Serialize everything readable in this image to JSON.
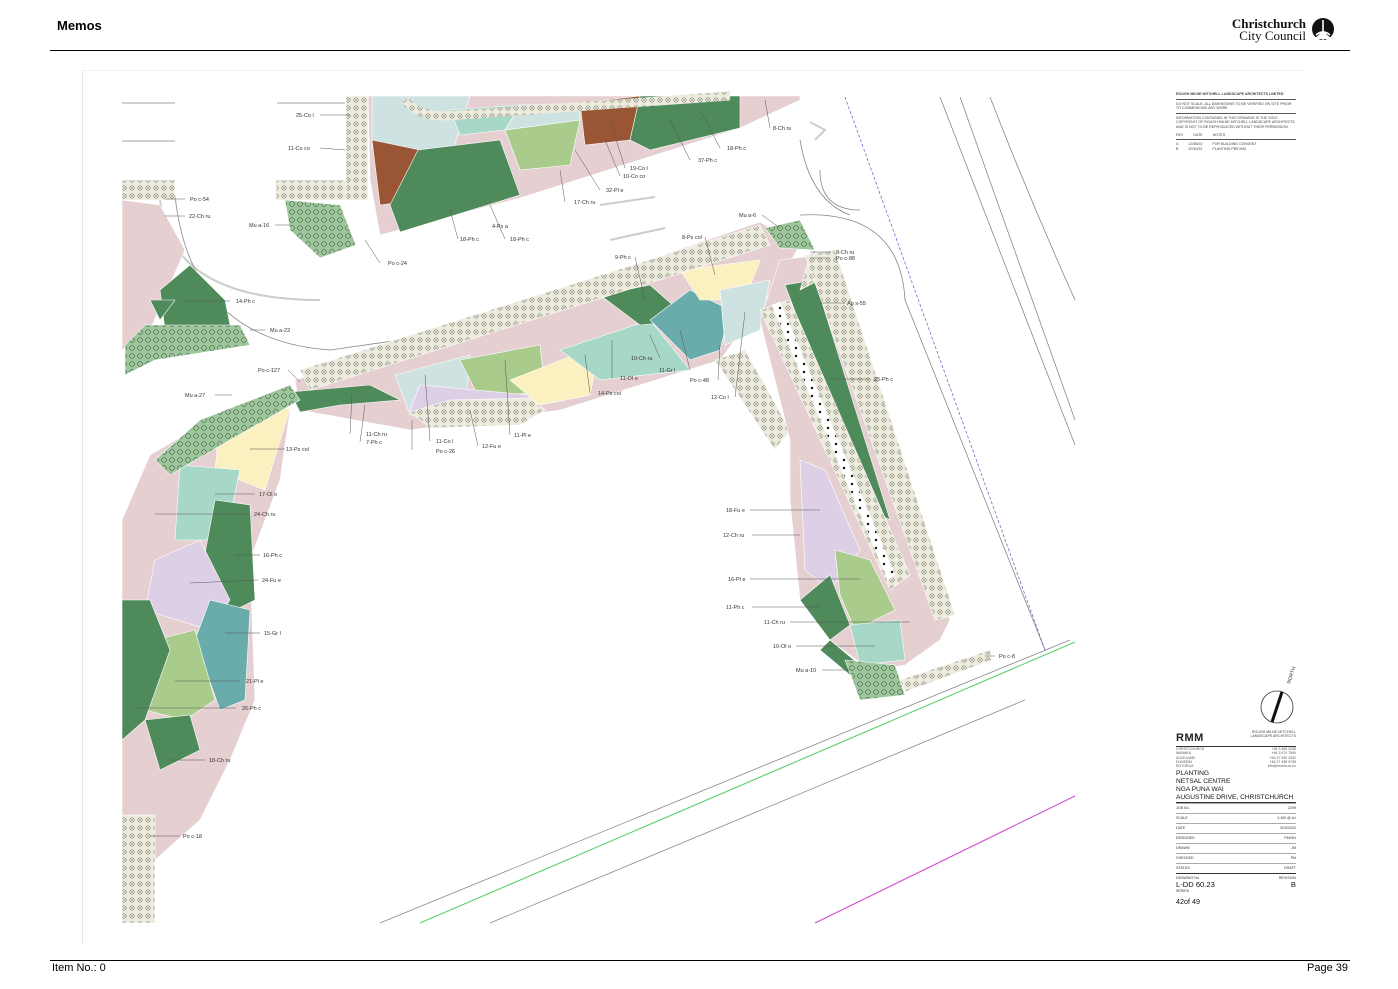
{
  "header": {
    "title": "Memos",
    "logo": {
      "line1": "Christchurch",
      "line2": "City Council"
    }
  },
  "footer": {
    "item_no": "Item No.: 0",
    "page": "Page 39"
  },
  "colors": {
    "dark_green": "#4f8a5b",
    "sage_green": "#a9cc8c",
    "pink": "#e5cfd0",
    "light_blue": "#cfe2e2",
    "mint": "#a7d7c6",
    "teal": "#6aabab",
    "lavender": "#ddd0e6",
    "pale_yellow": "#fbf0c0",
    "brown": "#9a5534",
    "mulch_cream": "#ecebdc",
    "mulch_green": "#9cc79a",
    "green_line": "#5bd06f",
    "magenta_line": "#d24ad8"
  },
  "north_label": "NORTH",
  "plant_labels": [
    "25-Co l",
    "11-Co co",
    "Po c-54",
    "22-Ch ru",
    "Mu a-16",
    "Po c-24",
    "18-Ph c",
    "18-Ph c",
    "4-Ps a",
    "17-Ch ru",
    "32-Pl e",
    "10-Co co",
    "19-Co l",
    "37-Ph c",
    "18-Ph c",
    "8-Ch ru",
    "Mu a-6",
    "8-Ps col",
    "8-Ch ru",
    "Po c-88",
    "9-Ph c",
    "14-Ph c",
    "Mu a-22",
    "Ap s-55",
    "Po c-127",
    "10-Ch ru",
    "11-Gr l",
    "11-Ol o",
    "Po c-48",
    "14-Ps col",
    "12-Co l",
    "25-Ph c",
    "Mu a-27",
    "11-Ch ru",
    "7-Ph c",
    "11-Co l",
    "Po c-26",
    "12-Fu e",
    "11-Pl e",
    "13-Ps col",
    "17-Ol o",
    "24-Ch ru",
    "16-Ph c",
    "24-Fu e",
    "15-Gr l",
    "21-Pl e",
    "26-Ph c",
    "18-Ch ru",
    "Po c-18",
    "18-Fu e",
    "12-Ch ru",
    "16-Pl e",
    "11-Ph c",
    "11-Ch ru",
    "10-Ol o",
    "Mu a-10",
    "Po c-8"
  ],
  "notes_block": [
    "ROUGH MILNE MITCHELL LANDSCAPE ARCHITECTS LIMITED",
    "DO NOT SCALE. ALL DIMENSIONS TO BE VERIFIED ON SITE PRIOR",
    "TO COMMENCING ANY WORK",
    "INFORMATION CONTAINED IN THIS DRAWING IS THE SOLE",
    "COPYRIGHT OF ROUGH MILNE MITCHELL LANDSCAPE ARCHITECTS",
    "AND IS NOT TO BE REPRODUCED WITHOUT THEIR PERMISSION"
  ],
  "revisions_header": [
    "REV",
    "DATE",
    "NOTES"
  ],
  "revisions": [
    {
      "rev": "A",
      "date": "12/08/22",
      "note": "FOR BUILDING CONSENT"
    },
    {
      "rev": "B",
      "date": "20/10/22",
      "note": "PLANTING PRICING"
    }
  ],
  "title_block": {
    "firm": "RMM",
    "firm_full": "ROUGH MILNE MITCHELL LANDSCAPE ARCHITECTS",
    "offices": [
      "CHRISTCHURCH",
      "WANAKA",
      "AUCKLAND",
      "DUNEDIN",
      "ROTORUA"
    ],
    "phones": [
      "+64 3 366 3268",
      "+64 3 974 7690",
      "+64 27 992 3302",
      "+64 27 458 9795",
      "info@rmmla.co.nz"
    ],
    "project": [
      "PLANTING",
      "NETSAL CENTRE",
      "NGA PUNA WAI",
      "AUGUSTINE DRIVE, CHRISTCHURCH"
    ],
    "rows": [
      {
        "label": "JOB No.",
        "value": "2299"
      },
      {
        "label": "SCALE",
        "value": "1:100 @ A1"
      },
      {
        "label": "DATE",
        "value": "3/10/2022"
      },
      {
        "label": "DESIGNED",
        "value": "PM/GH"
      },
      {
        "label": "DRAWN",
        "value": "JM"
      },
      {
        "label": "CHECKED",
        "value": "PM"
      },
      {
        "label": "STATUS",
        "value": "DRAFT"
      }
    ],
    "drawing_no_label": "DRAWING No.",
    "revision_label": "REVISION",
    "drawing_no": "L-DD 60.23",
    "revision": "B",
    "series_label": "SERIES",
    "sheet": "42of 49"
  }
}
